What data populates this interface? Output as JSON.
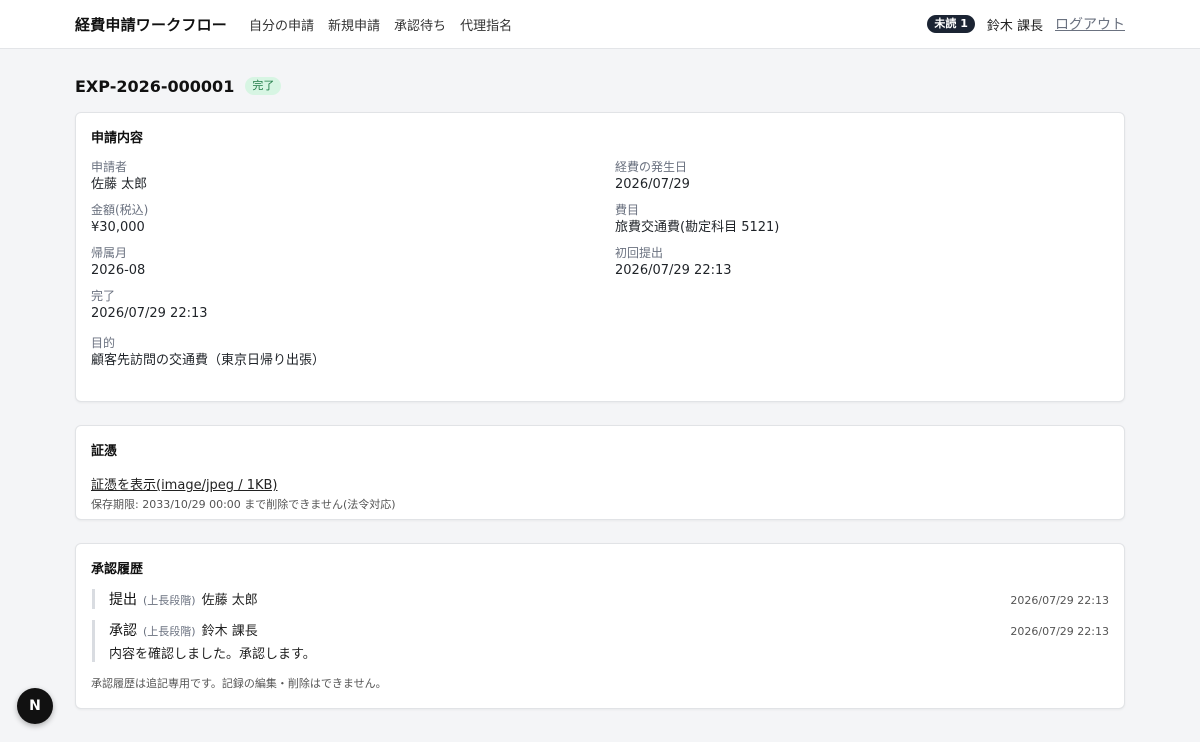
{
  "header": {
    "brand": "経費申請ワークフロー",
    "nav": [
      "自分の申請",
      "新規申請",
      "承認待ち",
      "代理指名"
    ],
    "unread_badge": "未読 1",
    "user": "鈴木 課長",
    "logout": "ログアウト"
  },
  "page": {
    "title": "EXP-2026-000001",
    "status": "完了"
  },
  "details": {
    "title": "申請内容",
    "fields": [
      {
        "label": "申請者",
        "value": "佐藤 太郎"
      },
      {
        "label": "経費の発生日",
        "value": "2026/07/29"
      },
      {
        "label": "金額(税込)",
        "value": "¥30,000"
      },
      {
        "label": "費目",
        "value": "旅費交通費(勘定科目 5121)"
      },
      {
        "label": "帰属月",
        "value": "2026-08"
      },
      {
        "label": "初回提出",
        "value": "2026/07/29 22:13"
      },
      {
        "label": "完了",
        "value": "2026/07/29 22:13"
      }
    ],
    "purpose": {
      "label": "目的",
      "value": "顧客先訪問の交通費（東京日帰り出張）"
    }
  },
  "evidence": {
    "title": "証憑",
    "link": "証憑を表示(image/jpeg / 1KB)",
    "retention": "保存期限: 2033/10/29 00:00 まで削除できません(法令対応)"
  },
  "history": {
    "title": "承認履歴",
    "entries": [
      {
        "action": "提出",
        "stage": "(上長段階)",
        "actor": "佐藤 太郎",
        "time": "2026/07/29 22:13",
        "comment": ""
      },
      {
        "action": "承認",
        "stage": "(上長段階)",
        "actor": "鈴木 課長",
        "time": "2026/07/29 22:13",
        "comment": "内容を確認しました。承認します。"
      }
    ],
    "note": "承認履歴は追記専用です。記録の編集・削除はできません。"
  },
  "fab": {
    "icon": "N"
  },
  "colors": {
    "status_badge_bg": "#d7f5e3",
    "status_badge_text": "#1e7a45",
    "unread_badge_bg": "#1b2433"
  }
}
